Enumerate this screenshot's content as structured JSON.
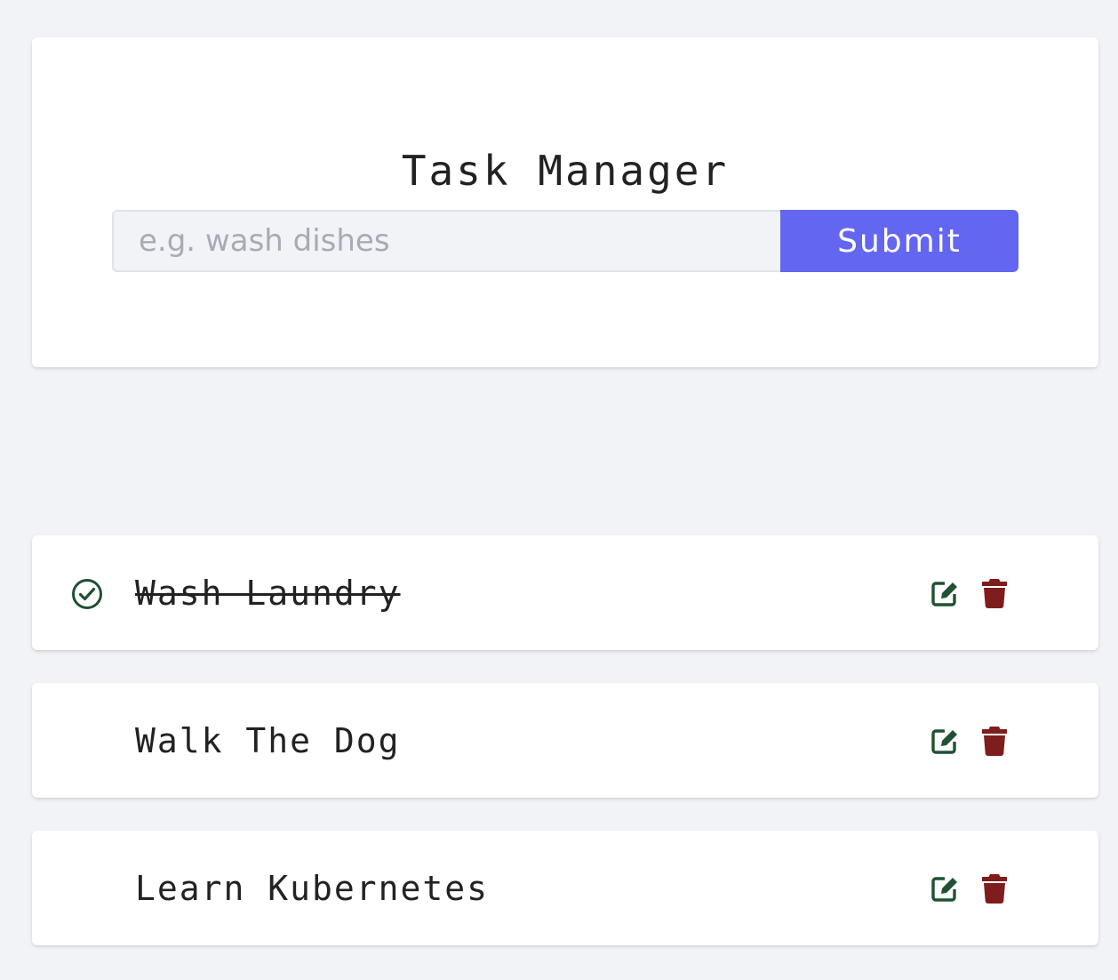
{
  "app": {
    "title": "Task Manager"
  },
  "form": {
    "placeholder": "e.g. wash dishes",
    "value": "",
    "submit_label": "Submit"
  },
  "tasks": [
    {
      "name": "Wash Laundry",
      "completed": true
    },
    {
      "name": "Walk The Dog",
      "completed": false
    },
    {
      "name": "Learn Kubernetes",
      "completed": false
    }
  ],
  "icons": {
    "completed": "check-circle-icon",
    "edit": "edit-icon",
    "delete": "trash-icon"
  },
  "colors": {
    "background": "#f1f3f7",
    "card": "#ffffff",
    "primary": "#6366f1",
    "input_background": "#f1f3f7",
    "input_border": "#dfe3ea",
    "placeholder": "#a6abb6",
    "text": "#222222",
    "edit_icon": "#1f5132",
    "delete_icon": "#7f1d1d",
    "check_icon": "#1f5132"
  }
}
